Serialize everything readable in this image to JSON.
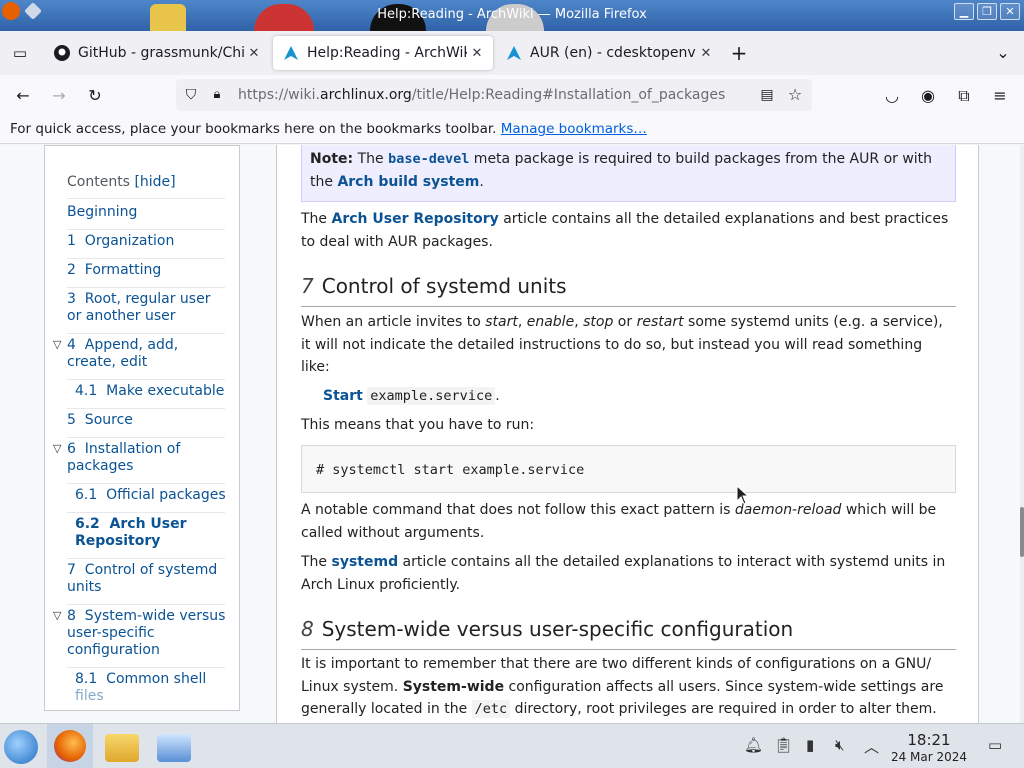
{
  "window": {
    "title": "Help:Reading - ArchWiki — Mozilla Firefox"
  },
  "tabs": [
    {
      "label": "GitHub - grassmunk/Chic",
      "close": "✕"
    },
    {
      "label": "Help:Reading - ArchWiki",
      "close": "✕"
    },
    {
      "label": "AUR (en) - cdesktopenv",
      "close": "✕"
    }
  ],
  "urlbar": {
    "prefix": "https://wiki.",
    "domain": "archlinux.org",
    "path": "/title/Help:Reading#Installation_of_packages"
  },
  "bookmarks": {
    "message": "For quick access, place your bookmarks here on the bookmarks toolbar.",
    "link": "Manage bookmarks…"
  },
  "toc": {
    "heading": "Contents",
    "toggle": "[hide]",
    "items": [
      {
        "label": "Beginning"
      },
      {
        "label": "1  Organization"
      },
      {
        "label": "2  Formatting"
      },
      {
        "label": "3  Root, regular user",
        "label2": "or another user"
      },
      {
        "label": "4  Append, add,",
        "label2": "create, edit"
      },
      {
        "label": "4.1  Make executable"
      },
      {
        "label": "5  Source"
      },
      {
        "label": "6  Installation of",
        "label2": "packages"
      },
      {
        "label": "6.1  Official packages"
      },
      {
        "label": "6.2  Arch User",
        "label2": "Repository"
      },
      {
        "label": "7  Control of systemd",
        "label2": "units"
      },
      {
        "label": "8  System-wide versus",
        "label2": "user-specific",
        "label3": "configuration"
      },
      {
        "label": "8.1  Common shell",
        "label2": "files"
      }
    ]
  },
  "article": {
    "note": {
      "prefix": "Note:",
      "t1": " The ",
      "pkg": "base-devel",
      "t2": " meta package is required to build packages from the AUR or with",
      "t3": "the ",
      "link": "Arch build system",
      "t4": "."
    },
    "aur_para": {
      "t1": "The ",
      "link": "Arch User Repository",
      "t2": " article contains all the detailed explanations and best practices",
      "t3": "to deal with AUR packages."
    },
    "section7": {
      "num": "7",
      "title": "Control of systemd units"
    },
    "s7_para1": {
      "a": "When an article invites to ",
      "start": "start",
      "b": ", ",
      "enable": "enable",
      "c": ", ",
      "stop": "stop",
      "d": " or ",
      "restart": "restart",
      "e": " some systemd units (e.g. a service),",
      "line2": "it will not indicate the detailed instructions to do so, but instead you will read something",
      "line3": "like:"
    },
    "start_example": {
      "action": "Start",
      "unit": "example.service",
      "end": "."
    },
    "run_label": "This means that you have to run:",
    "command": "# systemctl start example.service",
    "notable": {
      "a": "A notable command that does not follow this exact pattern is ",
      "cmd": "daemon-reload",
      "b": " which will be",
      "line2": "called without arguments."
    },
    "systemd_para": {
      "a": "The ",
      "link": "systemd",
      "b": " article contains all the detailed explanations to interact with systemd units in",
      "line2": "Arch Linux proficiently."
    },
    "section8": {
      "num": "8",
      "title": "System-wide versus user-specific configuration"
    },
    "s8_para": {
      "line1": "It is important to remember that there are two different kinds of configurations on a GNU/",
      "a": "Linux system. ",
      "bold": "System-wide",
      "b": " configuration affects all users. Since system-wide settings are",
      "c": "generally located in the ",
      "path": "/etc",
      "d": " directory, root privileges are required in order to alter them."
    }
  },
  "taskbar": {
    "time": "18:21",
    "date": "24 Mar 2024"
  }
}
